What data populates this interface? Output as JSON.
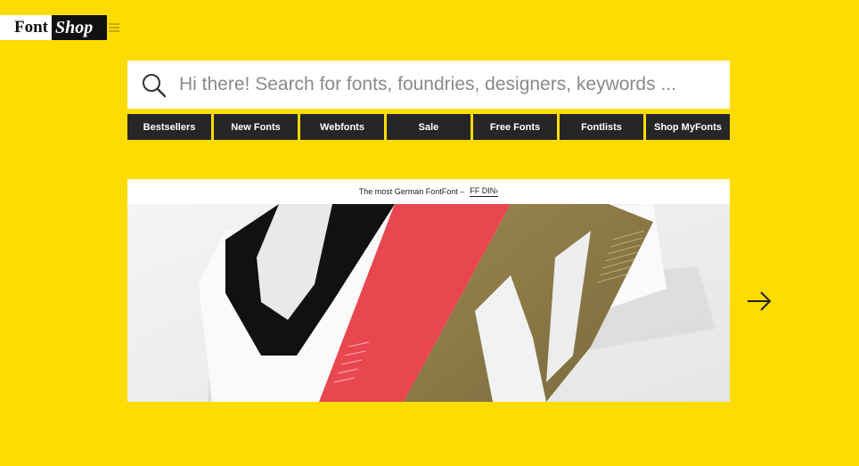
{
  "logo": {
    "part1": "Font",
    "part2": "Shop"
  },
  "search": {
    "placeholder": "Hi there! Search for fonts, foundries, designers, keywords ..."
  },
  "nav": {
    "items": [
      "Bestsellers",
      "New Fonts",
      "Webfonts",
      "Sale",
      "Free Fonts",
      "Fontlists",
      "Shop MyFonts"
    ]
  },
  "feature": {
    "caption": "The most German FontFont –",
    "link": "FF DIN›"
  },
  "icons": {
    "search": "search-icon",
    "menu": "menu-icon",
    "next": "arrow-right-icon"
  },
  "colors": {
    "background": "#FFDC00",
    "nav": "#262626",
    "accent_red": "#E8474F",
    "accent_gold": "#8C7A45"
  }
}
